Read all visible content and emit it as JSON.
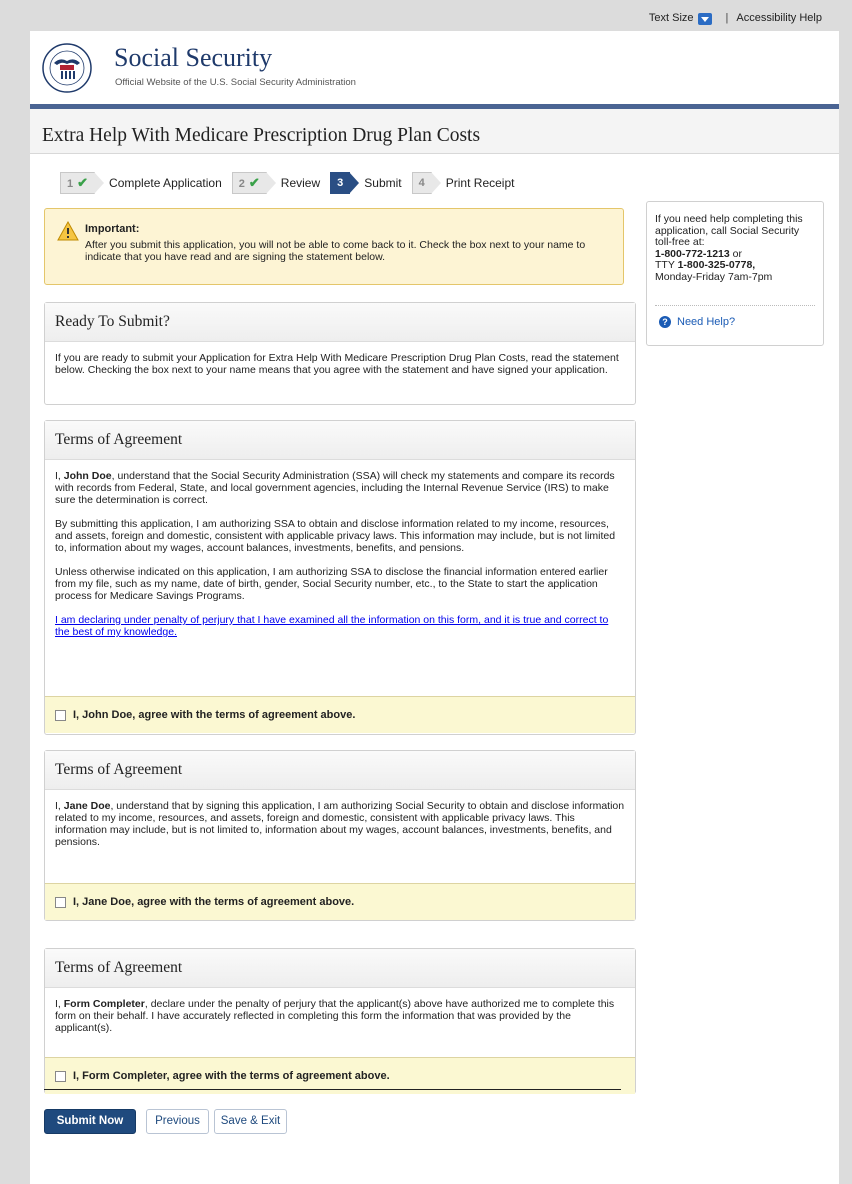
{
  "topbar": {
    "text_size": "Text Size",
    "separator": "|",
    "accessibility": "Accessibility Help"
  },
  "header": {
    "title": "Social Security",
    "subtitle": "Official Website of the U.S. Social Security Administration"
  },
  "page_title": "Extra Help With Medicare Prescription Drug Plan Costs",
  "steps": [
    {
      "num": "1",
      "label": "Complete Application",
      "done": true
    },
    {
      "num": "2",
      "label": "Review",
      "done": true
    },
    {
      "num": "3",
      "label": "Submit",
      "active": true
    },
    {
      "num": "4",
      "label": "Print Receipt"
    }
  ],
  "important": {
    "title": "Important:",
    "text": "After you submit this application, you will not be able to come back to it. Check the box next to your name to indicate that you have read and are signing the statement below."
  },
  "ready": {
    "title": "Ready To Submit?",
    "text": "If you are ready to submit your Application for Extra Help With Medicare Prescription Drug Plan Costs, read the statement below. Checking the box next to your name means that you agree with the statement and have signed your application."
  },
  "terms1": {
    "title": "Terms of Agreement",
    "p1_pre": "I, ",
    "p1_name": "John Doe",
    "p1_post": ", understand that the Social Security Administration (SSA) will check my statements and compare its records with records from Federal, State, and local government agencies, including the Internal Revenue Service (IRS) to make sure the determination is correct.",
    "p2": "By submitting this application, I am authorizing SSA to obtain and disclose information related to my income, resources, and assets, foreign and domestic, consistent with applicable privacy laws. This information may include, but is not limited to, information about my wages, account balances, investments, benefits, and pensions.",
    "p3": "Unless otherwise indicated on this application, I am authorizing SSA to disclose the financial information entered earlier from my file, such as my name, date of birth, gender, Social Security number, etc., to the State to start the application process for Medicare Savings Programs.",
    "link": "I am declaring under penalty of perjury that I have examined all the information on this form, and it is true and correct to the best of my knowledge.",
    "agree": "I, John Doe, agree with the terms of agreement above."
  },
  "terms2": {
    "title": "Terms of Agreement",
    "p1_pre": "I, ",
    "p1_name": "Jane Doe",
    "p1_post": ", understand that by signing this application, I am authorizing Social Security to obtain and disclose information related to my income, resources, and assets, foreign and domestic, consistent with applicable privacy laws. This information may include, but is not limited to, information about my wages, account balances, investments, benefits, and pensions.",
    "agree": "I, Jane Doe, agree with the terms of agreement above."
  },
  "terms3": {
    "title": "Terms of Agreement",
    "p1_pre": "I, ",
    "p1_name": "Form Completer",
    "p1_post": ", declare under the penalty of perjury that the applicant(s) above have authorized me to complete this form on their behalf.  I have accurately reflected in completing this form the information that was provided by the applicant(s).",
    "agree": "I, Form Completer, agree with the terms of agreement above."
  },
  "sidebar": {
    "line1": "If you need help completing this application, call Social Security toll-free at:",
    "phone": "1-800-772-1213",
    "or": " or",
    "tty_pre": "TTY ",
    "tty": "1-800-325-0778,",
    "hours": "Monday-Friday 7am-7pm",
    "help": "Need Help?"
  },
  "buttons": {
    "submit": "Submit Now",
    "previous": "Previous",
    "save_exit": "Save & Exit"
  }
}
